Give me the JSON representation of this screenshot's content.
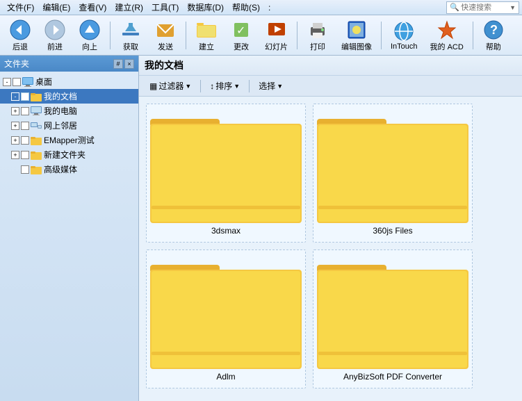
{
  "menubar": {
    "items": [
      {
        "label": "文件(F)"
      },
      {
        "label": "编辑(E)"
      },
      {
        "label": "查看(V)"
      },
      {
        "label": "建立(R)"
      },
      {
        "label": "工具(T)"
      },
      {
        "label": "数据库(D)"
      },
      {
        "label": "帮助(S)"
      }
    ],
    "search_placeholder": "快速搜索",
    "search_label": "快速搜索"
  },
  "toolbar": {
    "buttons": [
      {
        "id": "back",
        "label": "后退",
        "icon": "←"
      },
      {
        "id": "forward",
        "label": "前进",
        "icon": "→"
      },
      {
        "id": "up",
        "label": "向上",
        "icon": "↑"
      },
      {
        "id": "get",
        "label": "获取",
        "icon": "⬇"
      },
      {
        "id": "send",
        "label": "发送",
        "icon": "✉"
      },
      {
        "id": "build",
        "label": "建立",
        "icon": "📁"
      },
      {
        "id": "modify",
        "label": "更改",
        "icon": "✏"
      },
      {
        "id": "slideshow",
        "label": "幻灯片",
        "icon": "▶"
      },
      {
        "id": "print",
        "label": "打印",
        "icon": "🖨"
      },
      {
        "id": "border",
        "label": "编辑图像",
        "icon": "🖼"
      },
      {
        "id": "intouch",
        "label": "InTouch",
        "icon": "🌐"
      },
      {
        "id": "acd",
        "label": "我的 ACD",
        "icon": "⭐"
      },
      {
        "id": "help",
        "label": "帮助",
        "icon": "?"
      }
    ]
  },
  "sidebar": {
    "title": "文件夹",
    "close_btn": "×",
    "pin_btn": "#",
    "tree": [
      {
        "id": "desktop",
        "label": "桌面",
        "level": 0,
        "expanded": true,
        "has_toggle": true,
        "icon": "desktop"
      },
      {
        "id": "mydocs",
        "label": "我的文档",
        "level": 1,
        "expanded": true,
        "has_toggle": true,
        "selected": true,
        "icon": "folder"
      },
      {
        "id": "mypc",
        "label": "我的电脑",
        "level": 1,
        "expanded": false,
        "has_toggle": true,
        "icon": "computer"
      },
      {
        "id": "network",
        "label": "网上邻居",
        "level": 1,
        "expanded": false,
        "has_toggle": true,
        "icon": "network"
      },
      {
        "id": "emapper",
        "label": "EMapper测试",
        "level": 1,
        "expanded": false,
        "has_toggle": true,
        "icon": "folder"
      },
      {
        "id": "newfolder",
        "label": "新建文件夹",
        "level": 1,
        "expanded": false,
        "has_toggle": true,
        "icon": "folder"
      },
      {
        "id": "broadband",
        "label": "高级媒体",
        "level": 1,
        "expanded": false,
        "has_toggle": false,
        "icon": "folder"
      }
    ]
  },
  "content": {
    "title": "我的文档",
    "toolbar": {
      "filter_label": "过滤器",
      "sort_label": "排序",
      "select_label": "选择"
    },
    "folders": [
      {
        "id": "3dsmax",
        "label": "3dsmax"
      },
      {
        "id": "360js",
        "label": "360js Files"
      },
      {
        "id": "adlm",
        "label": "Adlm"
      },
      {
        "id": "anybizsoft",
        "label": "AnyBizSoft PDF Converter"
      }
    ]
  },
  "colors": {
    "toolbar_bg_top": "#f0f6ff",
    "toolbar_bg_bottom": "#dceaf8",
    "sidebar_header": "#5b9ad5",
    "selected_bg": "#3c78c0",
    "folder_body": "#f5c842",
    "folder_tab": "#e8b030",
    "content_bg": "#e8f2fb",
    "accent": "#4a88c7"
  }
}
